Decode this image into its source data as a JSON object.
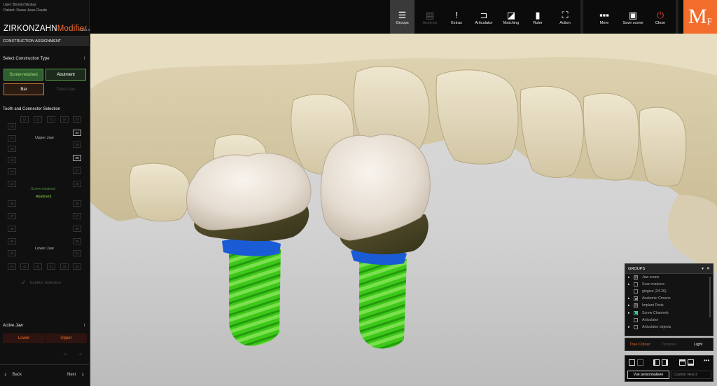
{
  "user_line": "User: Bonnin Nicolas",
  "patient_line": "Patient: Dusse Jean-Claude",
  "brand": {
    "name": "ZIRKONZAHN",
    "accent": "Modifier",
    "version": "v.25.1.8686"
  },
  "assignment_header": "CONSTRUCTION ASSIGNMENT",
  "construction": {
    "title": "Select Construction Type",
    "info": "i",
    "screw_retained": "Screw-retained",
    "abutment": "Abutment",
    "bar": "Bar",
    "telescope": "Telescope"
  },
  "teeth": {
    "title": "Tooth and Connector Selection",
    "upper_row": [
      "18",
      "17",
      "16",
      "15",
      "14",
      "13",
      "12",
      "11",
      "21",
      "22",
      "23",
      "24",
      "25",
      "26",
      "27",
      "28"
    ],
    "lower_row": [
      "48",
      "47",
      "46",
      "45",
      "44",
      "43",
      "42",
      "41",
      "31",
      "32",
      "33",
      "34",
      "35",
      "36",
      "37",
      "38"
    ],
    "upper_jaw": "Upper Jaw",
    "lower_jaw": "Lower Jaw",
    "legend_screw": "Screw-retained",
    "legend_abutment": "Abutment",
    "confirm": "Confirm Selection"
  },
  "active_jaw": {
    "title": "Active Jaw",
    "info": "i",
    "lower": "Lower",
    "upper": "Upper"
  },
  "nav": {
    "back": "Back",
    "next": "Next"
  },
  "toolbar": {
    "groups": "Groups",
    "analysis": "Analysis",
    "extras": "Extras",
    "articulator": "Articulator",
    "matching": "Matching",
    "ruler": "Ruler",
    "action": "Action",
    "more": "More",
    "save_scene": "Save scene",
    "close": "Close",
    "logo_m": "M",
    "logo_f": "F"
  },
  "groups_panel": {
    "title": "GROUPS",
    "items": [
      {
        "label": "Jaw scans",
        "expand": true,
        "check": "on"
      },
      {
        "label": "Scan markers",
        "expand": true,
        "check": "off"
      },
      {
        "label": "gingiva (24-26)",
        "expand": false,
        "check": "off"
      },
      {
        "label": "Anatomic Crowns",
        "expand": true,
        "check": "partial"
      },
      {
        "label": "Implant Parts",
        "expand": true,
        "check": "on"
      },
      {
        "label": "Screw Channels",
        "expand": true,
        "check": "teal"
      },
      {
        "label": "Articulator",
        "expand": false,
        "check": "off"
      },
      {
        "label": "Articulator objects",
        "expand": true,
        "check": "off"
      }
    ]
  },
  "shading": {
    "true_colour": "True Colour",
    "textures": "Textures",
    "light": "Light"
  },
  "views": {
    "custom_selected": "Vue personnalisée",
    "custom2": "Custom view 2",
    "more": "•••"
  },
  "colors": {
    "accent": "#f26d2c",
    "abutment_green": "#5a9a4a",
    "screw_green": "#3ecb1a",
    "implant_blue": "#1a5cd6",
    "crown": "#e8e0d4",
    "jaw_scan": "#d6caa6",
    "collar": "#4a4526"
  }
}
